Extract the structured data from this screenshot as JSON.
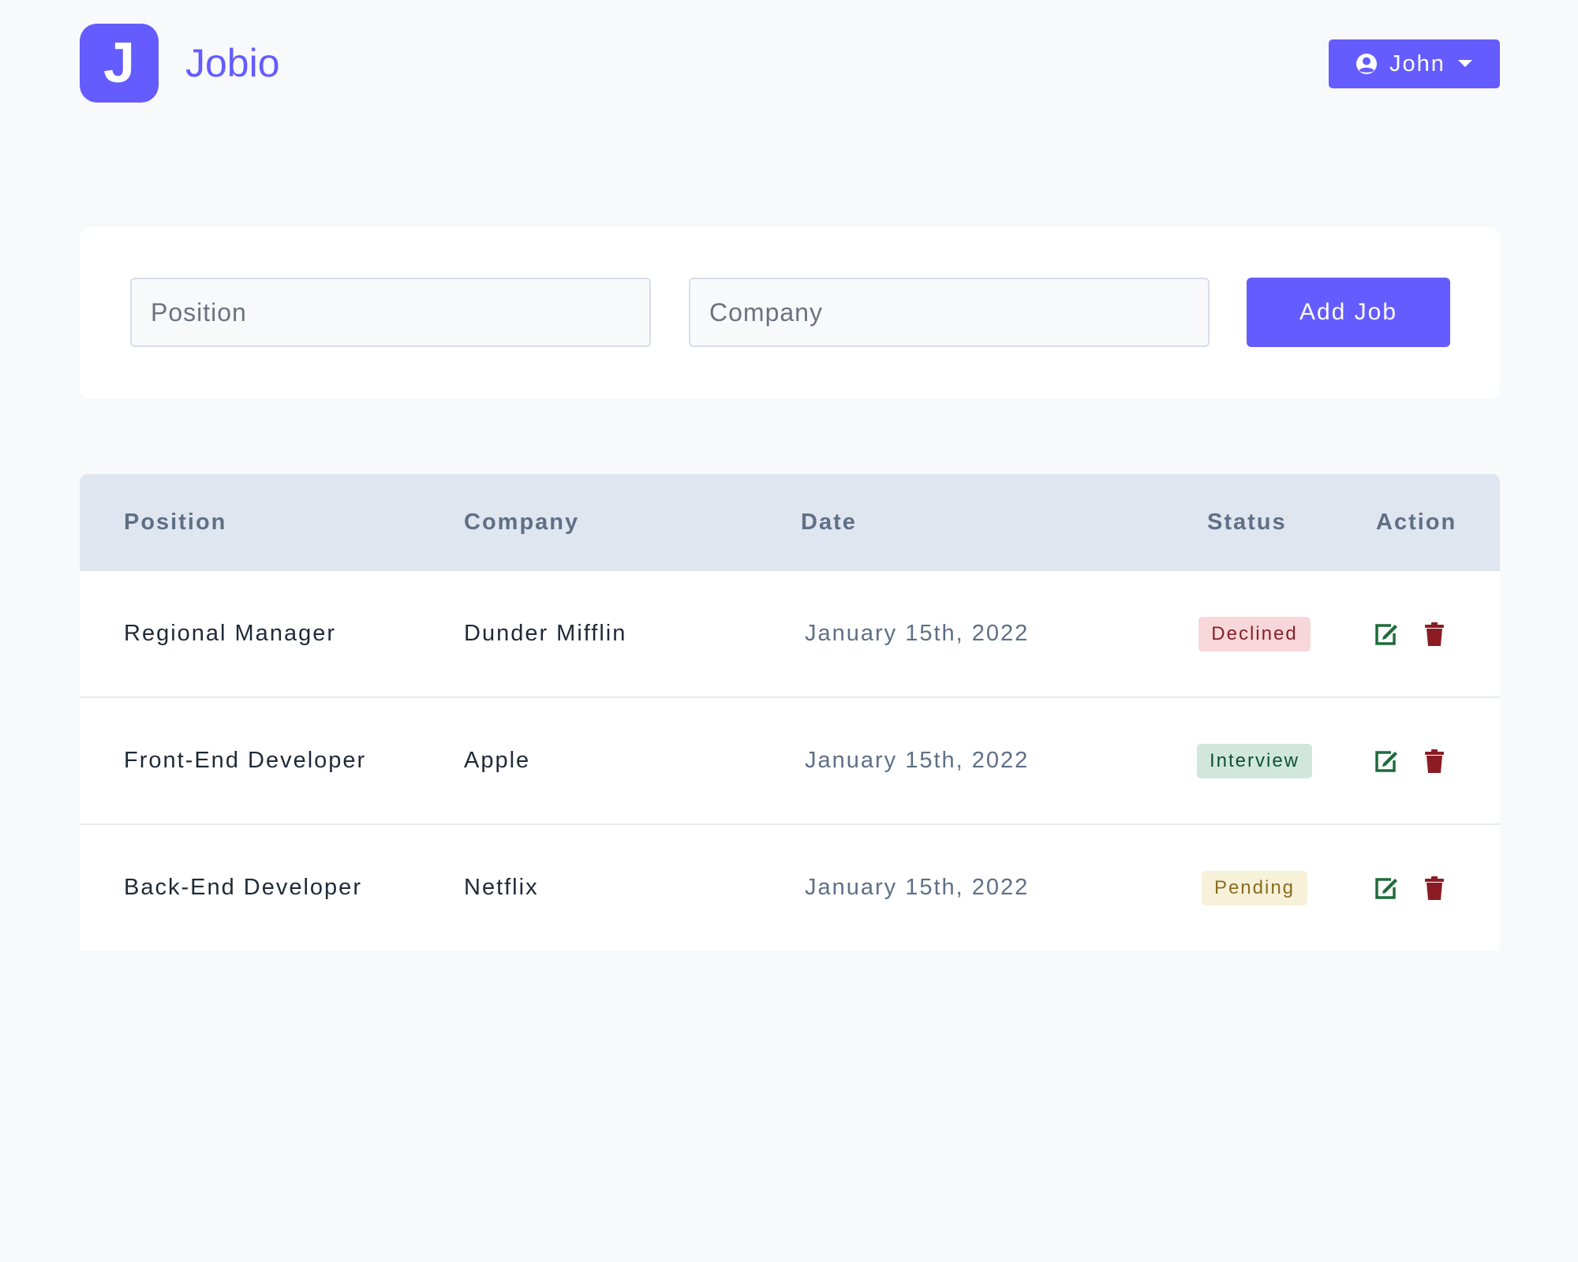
{
  "header": {
    "logo_letter": "J",
    "brand": "Jobio",
    "user_label": "John",
    "colors": {
      "accent": "#645cff"
    },
    "icons": {
      "user": "user-circle-icon",
      "caret": "caret-down-icon"
    }
  },
  "form": {
    "position_placeholder": "Position",
    "company_placeholder": "Company",
    "add_label": "Add Job"
  },
  "table": {
    "headers": {
      "position": "Position",
      "company": "Company",
      "date": "Date",
      "status": "Status",
      "action": "Action"
    },
    "rows": [
      {
        "position": "Regional Manager",
        "company": "Dunder Mifflin",
        "date": "January 15th, 2022",
        "status": "Declined",
        "status_bg": "#f8d7da",
        "status_fg": "#842029"
      },
      {
        "position": "Front-End Developer",
        "company": "Apple",
        "date": "January 15th, 2022",
        "status": "Interview",
        "status_bg": "#d1e7dd",
        "status_fg": "#0f5132"
      },
      {
        "position": "Back-End Developer",
        "company": "Netflix",
        "date": "January 15th, 2022",
        "status": "Pending",
        "status_bg": "#f7f1d9",
        "status_fg": "#8a6d22"
      }
    ],
    "icons": {
      "edit": "edit-icon",
      "delete": "trash-icon"
    },
    "colors": {
      "edit": "#1f6b3a",
      "delete": "#8b1c24"
    }
  }
}
